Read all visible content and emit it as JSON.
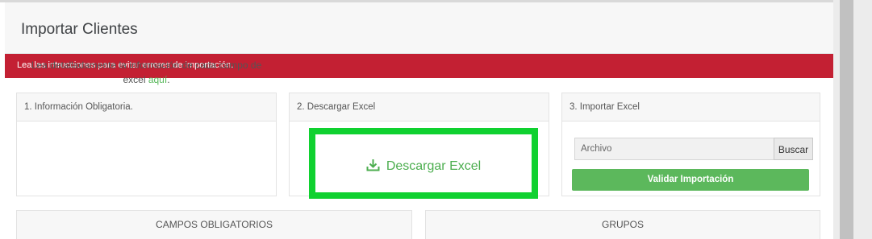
{
  "page": {
    "title": "Importar Clientes"
  },
  "alert": {
    "message": "Lea las intrucciones para evitar errores de importación.",
    "color": "#c32033"
  },
  "cards": {
    "info": {
      "header": "1. Información Obligatoria.",
      "text_line1": "Lea detalladamente la información de cada campo de",
      "text_line2_prefix": "excel ",
      "link_text": "aquí",
      "text_line2_suffix": "."
    },
    "download": {
      "header": "2. Descargar Excel",
      "button_label": "Descargar Excel",
      "icon": "download-icon",
      "highlight_color": "#10d130"
    },
    "import": {
      "header": "3. Importar Excel",
      "file_placeholder": "Archivo",
      "browse_label": "Buscar",
      "validate_label": "Validar Importación",
      "accent": "#5cb85c"
    }
  },
  "sections": {
    "required_fields": "CAMPOS OBLIGATORIOS",
    "groups": "GRUPOS"
  }
}
